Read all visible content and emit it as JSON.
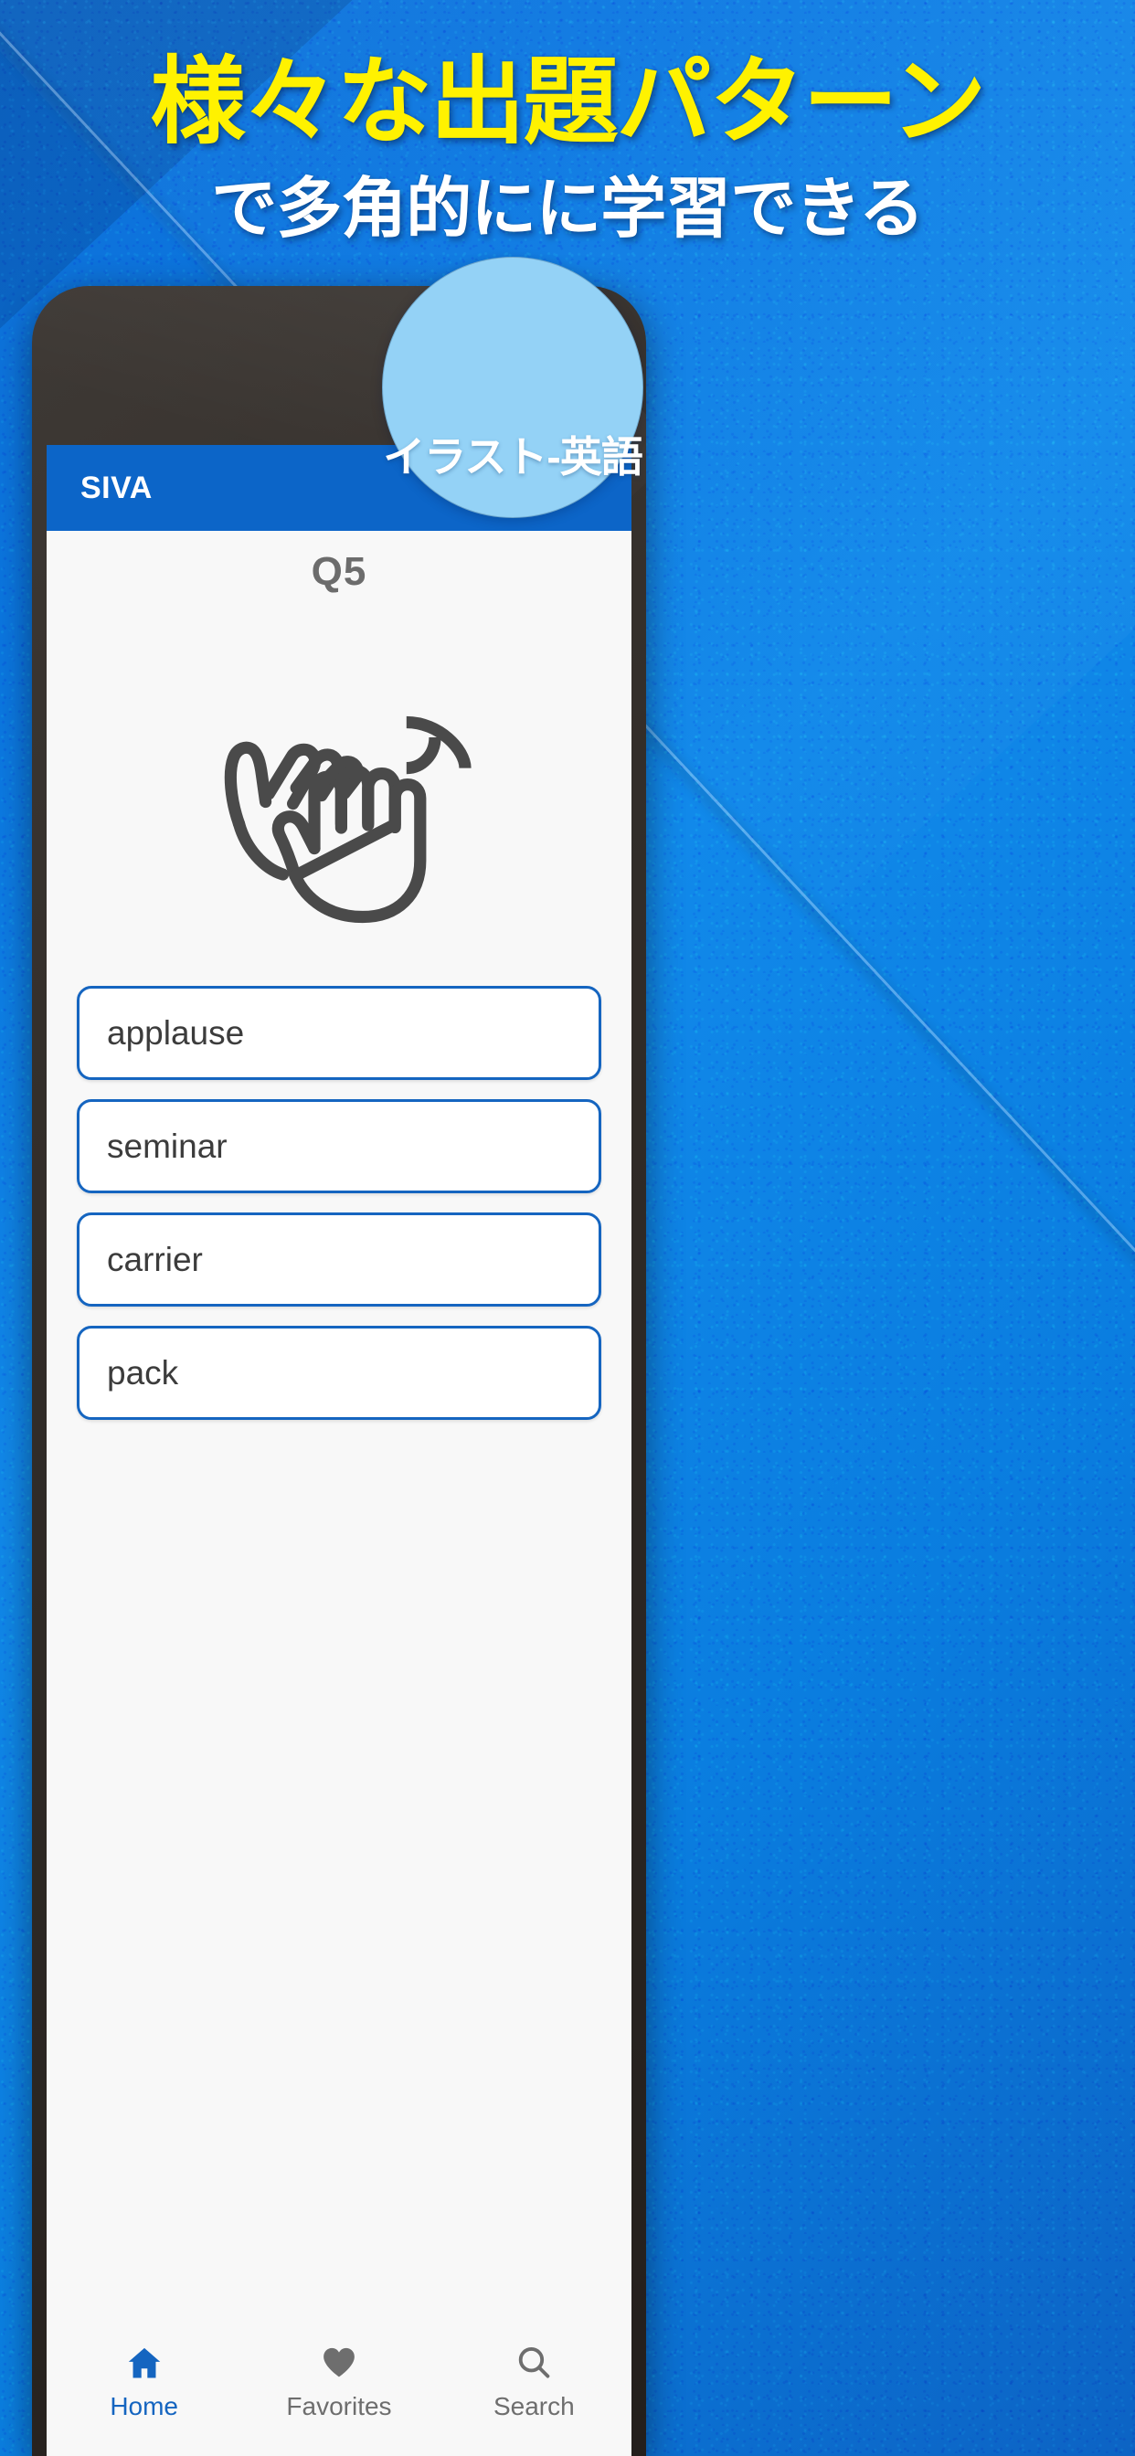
{
  "promo": {
    "headline": "様々な出題パターン",
    "subhead": "で多角的にに学習できる",
    "headline_color": "#FFF200",
    "subhead_color": "#FFFFFF",
    "background_color": "#0B76E0"
  },
  "badge": {
    "label": "イラスト-英語",
    "fill_color": "#94D2F6",
    "text_color": "#FFFFFF"
  },
  "app": {
    "appbar": {
      "title": "SIVA",
      "background_color": "#0C65C8",
      "title_color": "#FFFFFF"
    },
    "question": {
      "number_label": "Q5",
      "illustration": "clapping-hands-icon",
      "illustration_color": "#4A4A4A"
    },
    "options": [
      {
        "label": "applause"
      },
      {
        "label": "seminar"
      },
      {
        "label": "carrier"
      },
      {
        "label": "pack"
      }
    ],
    "option_border_color": "#1565C0",
    "bottom_nav": {
      "items": [
        {
          "label": "Home",
          "icon": "home-icon",
          "active": true
        },
        {
          "label": "Favorites",
          "icon": "heart-icon",
          "active": false
        },
        {
          "label": "Search",
          "icon": "search-icon",
          "active": false
        }
      ],
      "active_color": "#1565C0",
      "inactive_color": "#6E6E6E"
    }
  }
}
